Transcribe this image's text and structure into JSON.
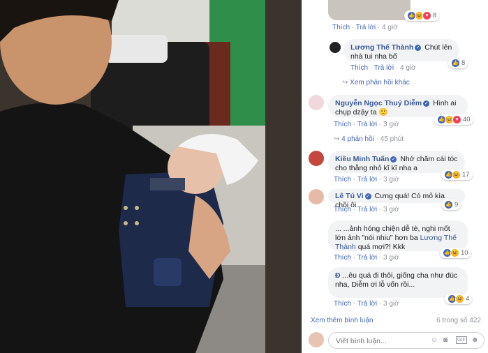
{
  "comments": [
    {
      "actions": [
        "Thích",
        "Trả lời",
        "4 giờ"
      ],
      "reactions": "8"
    },
    {
      "author": "Lương Thế Thành",
      "text": "Chút lên nhà tui nha bố",
      "actions": [
        "Thích",
        "Trả lời",
        "4 giờ"
      ],
      "reactions": "8"
    },
    {
      "see_more": "Xem phản hồi khác"
    },
    {
      "author": "Nguyễn Ngọc Thuý Diễm",
      "text": "Hình ai chụp dzậy ta",
      "actions": [
        "Thích",
        "Trả lời",
        "3 giờ"
      ],
      "reactions": "40"
    },
    {
      "replies_link": "4 phản hồi",
      "time": "45 phút"
    },
    {
      "author": "Kiều Minh Tuấn",
      "text": "Nhớ chăm cái tóc cho thằng nhỏ kĩ kĩ nha a",
      "actions": [
        "Thích",
        "Trả lời",
        "3 giờ"
      ],
      "reactions": "17"
    },
    {
      "author": "Lê Tú Vi",
      "text": "Cưng quá! Có mỏ kìa chồi ôi",
      "actions": [
        "Thích",
        "Trả lời",
        "3 giờ"
      ],
      "reactions": "9"
    },
    {
      "text_a": "... ...ảnh hóng chiện dễ tè, nghi mốt lớn ảnh \"nói nhiu\" hơn ba",
      "mention": "Lương Thế Thành",
      "text_b": "quá mợi?! Kkk",
      "actions": [
        "Thích",
        "Trả lời",
        "3 giờ"
      ],
      "reactions": "10"
    },
    {
      "author": "Đ",
      "text": "...êu quá đi thôi, giống cha như đúc nha, Diễm ơi lỗ vốn rồi...",
      "actions": [
        "Thích",
        "Trả lời",
        "3 giờ"
      ],
      "reactions": "4"
    }
  ],
  "footer": {
    "see_more": "Xem thêm bình luận",
    "count": "6 trong số 422"
  },
  "composer": {
    "placeholder": "Viết bình luận..."
  }
}
